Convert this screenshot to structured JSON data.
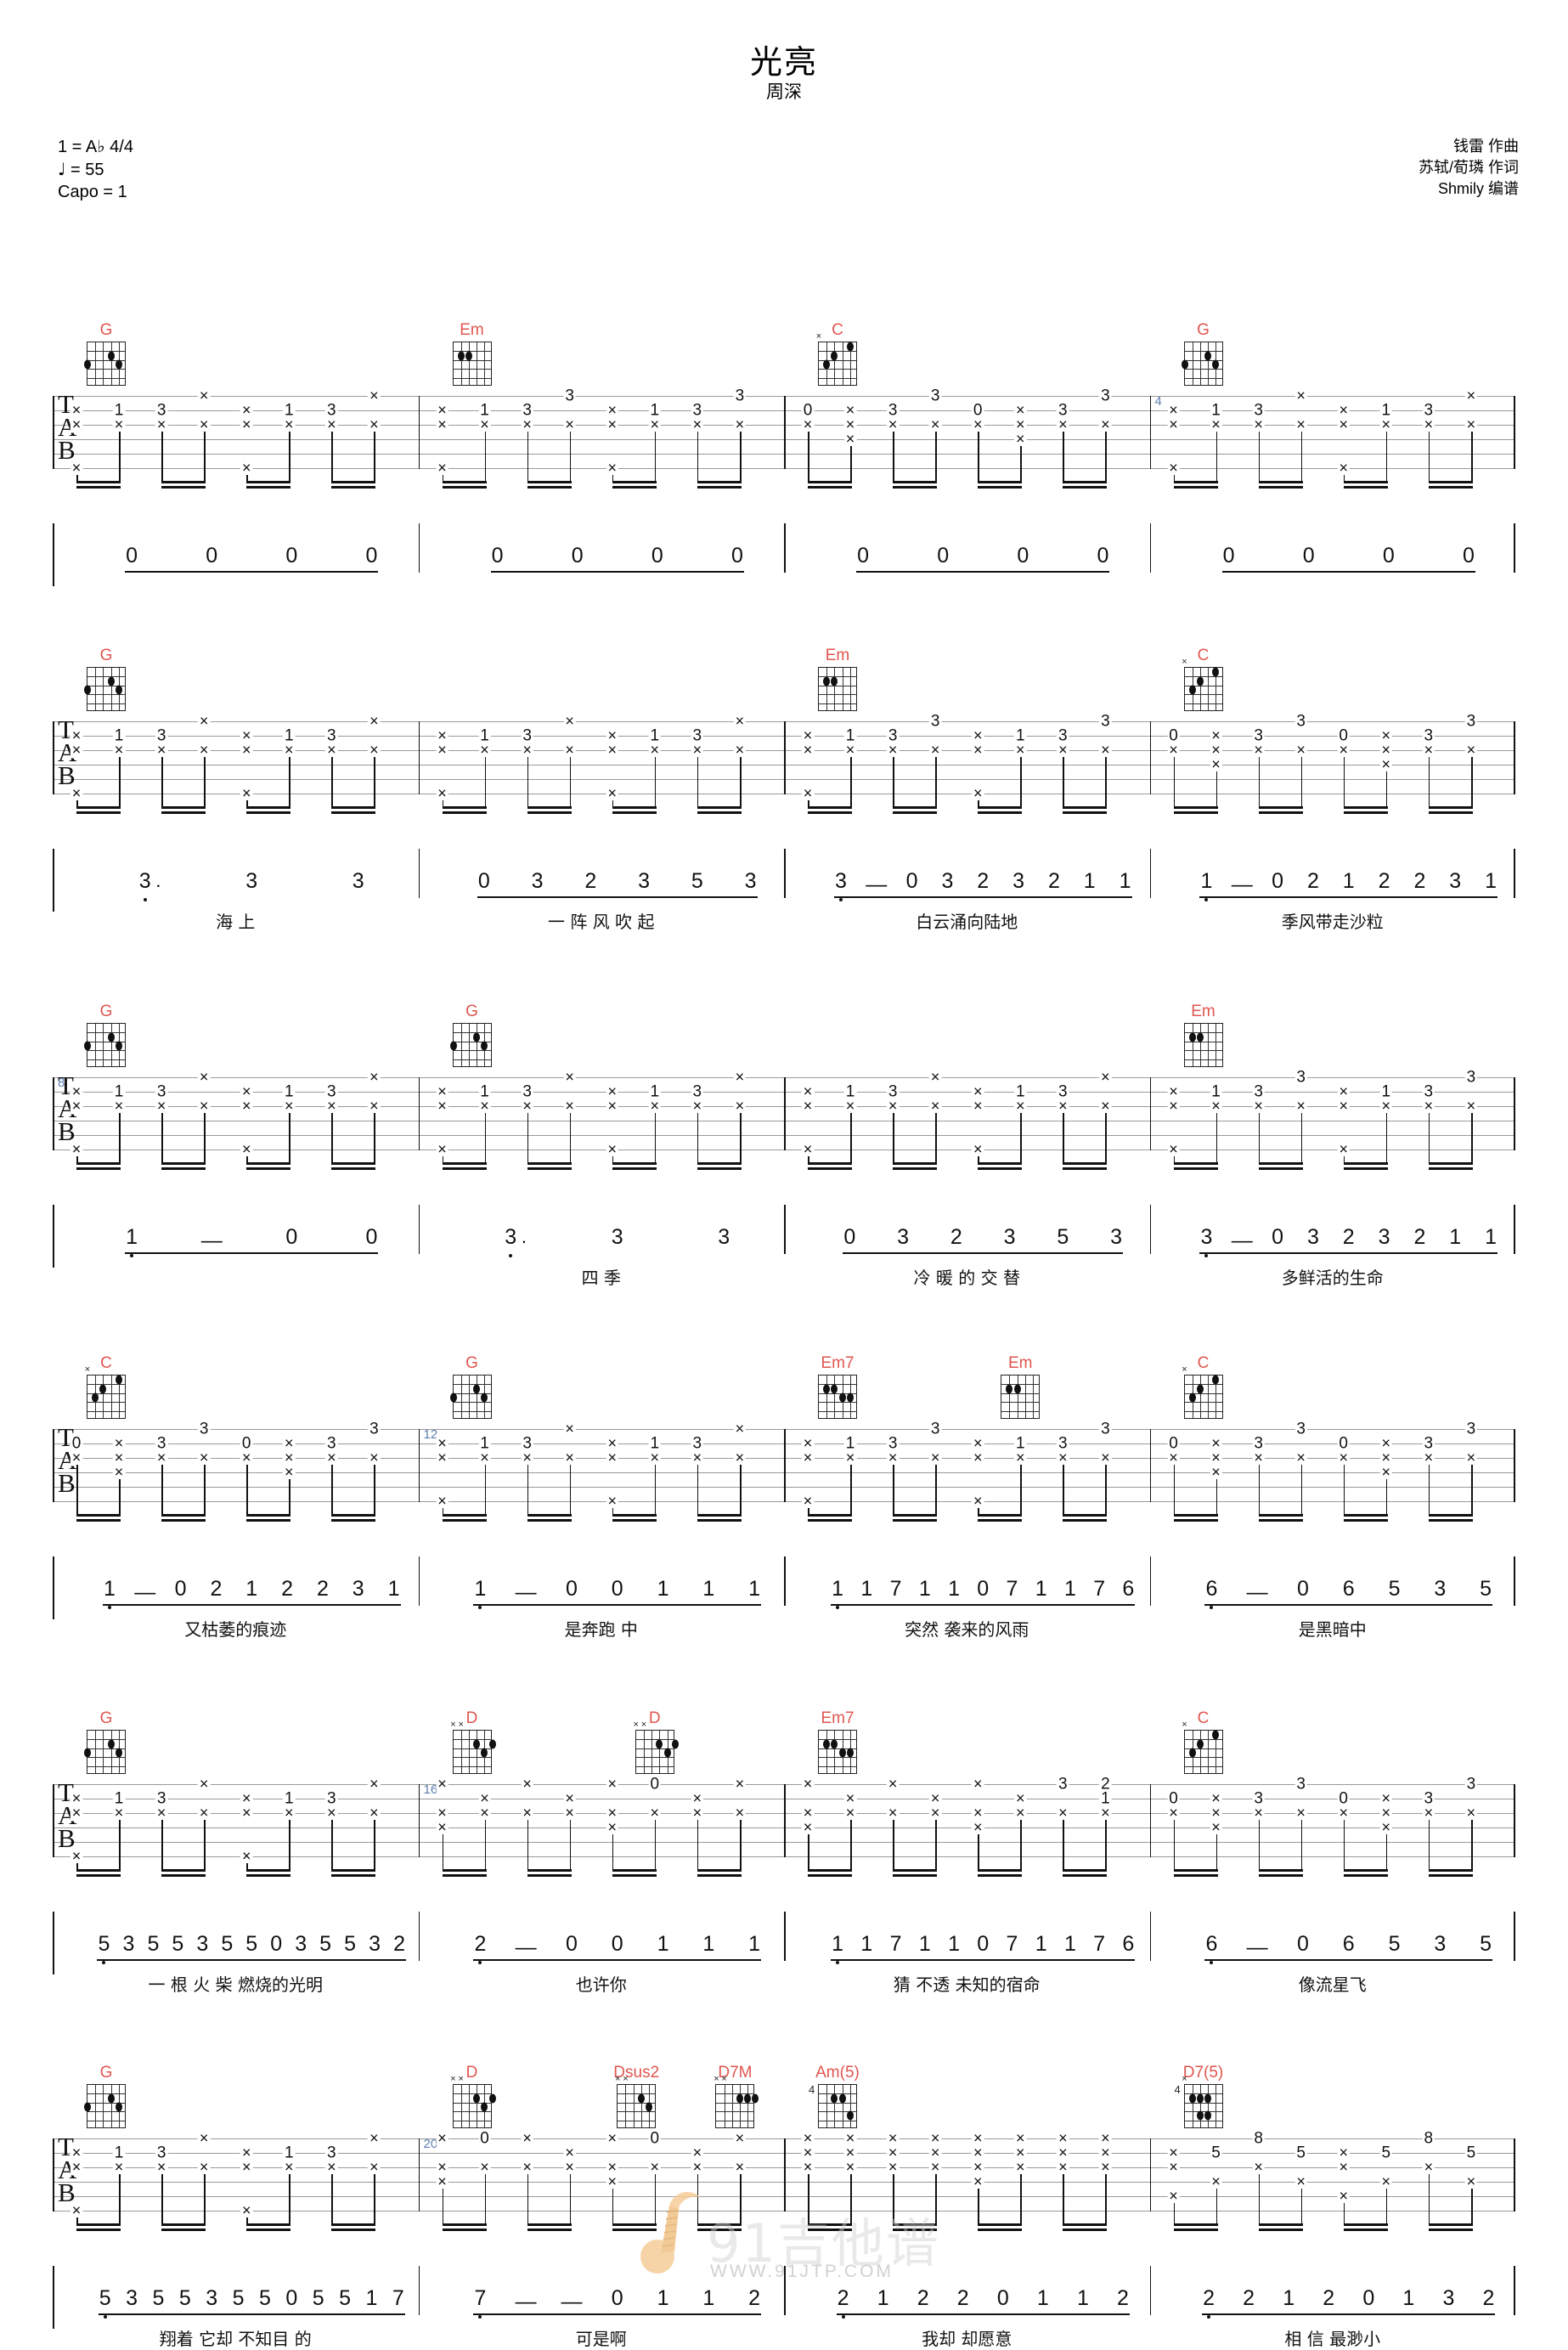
{
  "header": {
    "title": "光亮",
    "artist": "周深",
    "key_line": "1 = A♭  4/4",
    "tempo_line": "= 55",
    "capo_line": "Capo = 1",
    "credits": [
      "钱雷 作曲",
      "苏轼/荀璘 作词",
      "Shmily 编谱"
    ]
  },
  "watermark": {
    "text": "91吉他谱",
    "url": "WWW.91JTP.COM"
  },
  "colors": {
    "chord_name": "#e0564f",
    "measure_number": "#5f7fb0",
    "staff_line": "#9a9a9a",
    "ink": "#111111"
  },
  "systems": [
    {
      "index": 1,
      "measure_start": "",
      "measure_marks": [
        {
          "num": "4",
          "at": 3
        }
      ],
      "chords": [
        {
          "name": "G",
          "at": 0
        },
        {
          "name": "Em",
          "at": 1
        },
        {
          "name": "C",
          "at": 2
        },
        {
          "name": "G",
          "at": 3
        }
      ],
      "jianpu": [
        {
          "notes": "0  0  0  0",
          "lyric": ""
        },
        {
          "notes": "0  0  0  0",
          "lyric": ""
        },
        {
          "notes": "0  0  0  0",
          "lyric": ""
        },
        {
          "notes": "0  0  0  0",
          "lyric": ""
        }
      ]
    },
    {
      "index": 2,
      "measure_marks": [],
      "chords": [
        {
          "name": "G",
          "at": 0
        },
        {
          "name": "Em",
          "at": 2
        },
        {
          "name": "C",
          "at": 3
        }
      ],
      "jianpu": [
        {
          "notes": "3·  3  3",
          "lyric": "海     上"
        },
        {
          "notes": "0 3 2 3 5  3",
          "lyric": "一 阵 风 吹   起"
        },
        {
          "notes": "3  —  0  3 2 3 2 1 1",
          "lyric": "白云涌向陆地"
        },
        {
          "notes": "1  —  0  2 1 2 2 3 1",
          "lyric": "季风带走沙粒"
        }
      ]
    },
    {
      "index": 3,
      "measure_marks": [
        {
          "num": "8",
          "at": 0
        }
      ],
      "chords": [
        {
          "name": "G",
          "at": 0
        },
        {
          "name": "G",
          "at": 1
        },
        {
          "name": "Em",
          "at": 3
        }
      ],
      "jianpu": [
        {
          "notes": "1  —  0  0",
          "lyric": ""
        },
        {
          "notes": "3·  3  3",
          "lyric": "四     季"
        },
        {
          "notes": "0 3 2 3 5  3",
          "lyric": "冷 暖 的 交   替"
        },
        {
          "notes": "3  —  0  3 2 3 2 1 1",
          "lyric": "多鲜活的生命"
        }
      ]
    },
    {
      "index": 4,
      "measure_marks": [
        {
          "num": "12",
          "at": 1
        }
      ],
      "chords": [
        {
          "name": "C",
          "at": 0
        },
        {
          "name": "G",
          "at": 1
        },
        {
          "name": "Em7",
          "at": 2
        },
        {
          "name": "Em",
          "at": 2.5
        },
        {
          "name": "C",
          "at": 3
        }
      ],
      "jianpu": [
        {
          "notes": "1  —  0  2 1 2 2 3 1",
          "lyric": "又枯萎的痕迹"
        },
        {
          "notes": "1  —  0    0 1 1 1",
          "lyric": "是奔跑  中"
        },
        {
          "notes": "1    1 7 1 1  0 7 1 1 7 6",
          "lyric": "突然   袭来的风雨"
        },
        {
          "notes": "6  —  0   6 5 3 5",
          "lyric": "是黑暗中"
        }
      ]
    },
    {
      "index": 5,
      "measure_marks": [
        {
          "num": "16",
          "at": 1
        }
      ],
      "chords": [
        {
          "name": "G",
          "at": 0
        },
        {
          "name": "D",
          "at": 1
        },
        {
          "name": "D",
          "at": 1.5
        },
        {
          "name": "Em7",
          "at": 2
        },
        {
          "name": "C",
          "at": 3
        }
      ],
      "jianpu": [
        {
          "notes": "5  3 5 5  3 5 5  0 3 5 5 3 2",
          "lyric": "一 根   火 柴   燃烧的光明"
        },
        {
          "notes": "2  —  0    0 1 1 1",
          "lyric": "也许你"
        },
        {
          "notes": "1    1 7 1 1  0 7 1 1 7 6",
          "lyric": "猜    不透   未知的宿命"
        },
        {
          "notes": "6  —  0   6 5 3 5",
          "lyric": "像流星飞"
        }
      ]
    },
    {
      "index": 6,
      "measure_marks": [
        {
          "num": "20",
          "at": 1
        }
      ],
      "chords": [
        {
          "name": "G",
          "at": 0
        },
        {
          "name": "D",
          "at": 1
        },
        {
          "name": "Dsus2",
          "at": 1.45
        },
        {
          "name": "D7M",
          "at": 1.72
        },
        {
          "name": "Am(5)",
          "at": 2
        },
        {
          "name": "D7(5)",
          "at": 3
        }
      ],
      "jianpu": [
        {
          "notes": "5  3 5 5  3 5 5  0 5 5 1  7",
          "lyric": "翔着   它却   不知目 的"
        },
        {
          "notes": "7  —  —  0 1 1 2",
          "lyric": "可是啊"
        },
        {
          "notes": "2  1 2 2   0 1 1 2",
          "lyric": "我却    却愿意"
        },
        {
          "notes": "2    2  1  2   0 1 3 2",
          "lyric": "相   信    最渺小"
        }
      ]
    }
  ],
  "tab_label": [
    "T",
    "A",
    "B"
  ],
  "chord_shapes": {
    "G": {
      "frets": 5,
      "dots": [
        [
          2,
          3
        ],
        [
          3,
          2
        ],
        [
          3,
          6
        ]
      ],
      "mutes": [],
      "base": ""
    },
    "Em": {
      "frets": 5,
      "dots": [
        [
          2,
          5
        ],
        [
          2,
          4
        ]
      ],
      "mutes": [],
      "base": ""
    },
    "C": {
      "frets": 5,
      "dots": [
        [
          1,
          2
        ],
        [
          2,
          4
        ],
        [
          3,
          5
        ]
      ],
      "mutes": [
        6
      ],
      "base": ""
    },
    "Em7": {
      "frets": 5,
      "dots": [
        [
          2,
          5
        ],
        [
          2,
          4
        ],
        [
          3,
          3
        ],
        [
          3,
          2
        ]
      ],
      "mutes": [],
      "base": ""
    },
    "D": {
      "frets": 5,
      "dots": [
        [
          2,
          3
        ],
        [
          2,
          1
        ],
        [
          3,
          2
        ]
      ],
      "mutes": [
        6,
        5
      ],
      "base": ""
    },
    "Dsus2": {
      "frets": 5,
      "dots": [
        [
          2,
          3
        ],
        [
          3,
          2
        ]
      ],
      "mutes": [
        6,
        5
      ],
      "base": ""
    },
    "D7M": {
      "frets": 5,
      "dots": [
        [
          2,
          3
        ],
        [
          2,
          2
        ],
        [
          2,
          1
        ]
      ],
      "mutes": [
        6,
        5
      ],
      "base": ""
    },
    "Am(5)": {
      "frets": 5,
      "dots": [
        [
          2,
          4
        ],
        [
          2,
          3
        ],
        [
          4,
          2
        ]
      ],
      "mutes": [],
      "base": "4"
    },
    "D7(5)": {
      "frets": 5,
      "dots": [
        [
          2,
          5
        ],
        [
          2,
          4
        ],
        [
          2,
          3
        ],
        [
          4,
          4
        ],
        [
          4,
          3
        ]
      ],
      "mutes": [
        6
      ],
      "base": "4"
    }
  }
}
